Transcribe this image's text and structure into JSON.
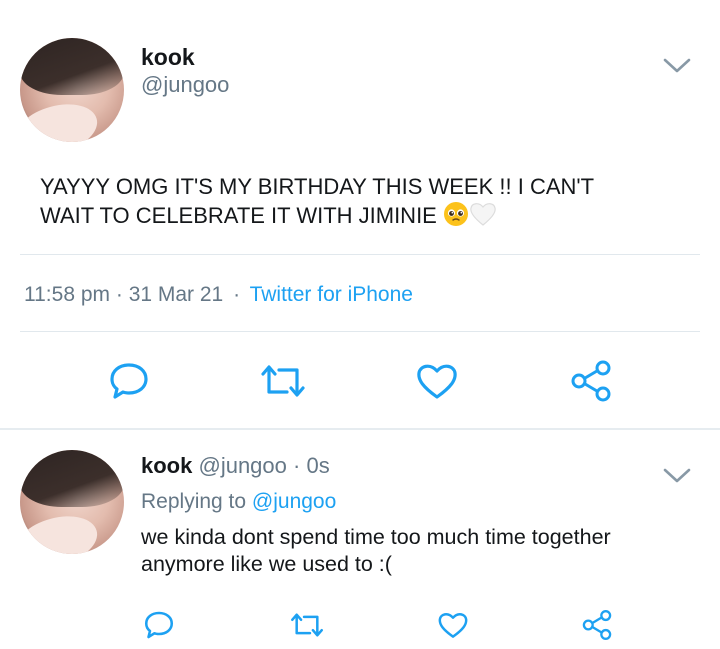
{
  "tweet": {
    "display_name": "kook",
    "handle": "@jungoo",
    "text_line1": "YAYYY OMG IT'S MY BIRTHDAY THIS WEEK !! I CAN'T",
    "text_line2": "WAIT TO CELEBRATE IT WITH JIMINIE",
    "time": "11:58 pm",
    "sep1": "·",
    "date": "31 Mar 21",
    "sep2": "·",
    "source": "Twitter for iPhone",
    "emojis": [
      "pleading-face",
      "white-heart"
    ]
  },
  "reply": {
    "display_name": "kook",
    "handle": "@jungoo",
    "sep": "·",
    "age": "0s",
    "replying_prefix": "Replying to",
    "replying_to": "@jungoo",
    "text_line1": "we kinda dont spend time too much time together",
    "text_line2": "anymore like we used to :("
  },
  "actions": [
    "reply",
    "retweet",
    "like",
    "share"
  ],
  "colors": {
    "link": "#1da1f2",
    "icon": "#1da1f2",
    "secondary_text": "#657786",
    "divider": "#e1e8ed"
  }
}
